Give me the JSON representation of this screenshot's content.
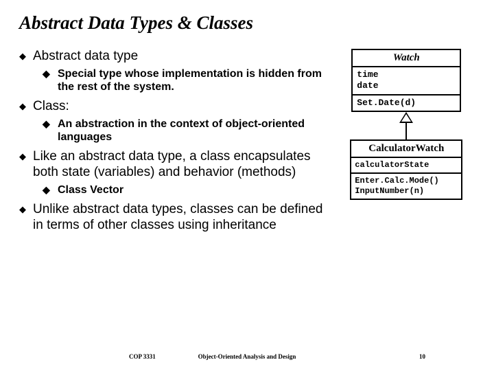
{
  "title": "Abstract Data Types & Classes",
  "bullets": {
    "b1": "Abstract data type",
    "b1_sub": "Special type whose implementation is hidden from the rest of the system.",
    "b2": "Class:",
    "b2_sub": "An abstraction in the context of object-oriented languages",
    "b3": "Like an abstract data type, a class encapsulates both state (variables) and behavior (methods)",
    "b3_sub": "Class Vector",
    "b4": "Unlike abstract data types, classes can be defined in terms of other classes using inheritance"
  },
  "uml": {
    "parent": {
      "name": "Watch",
      "attrs": "time\ndate",
      "ops": "Set.Date(d)"
    },
    "child": {
      "name": "CalculatorWatch",
      "attrs": "calculatorState",
      "ops": "Enter.Calc.Mode()\nInputNumber(n)"
    }
  },
  "footer": {
    "left": "COP 3331",
    "center": "Object-Oriented Analysis and Design",
    "right": "10"
  },
  "markers": {
    "diamond": "◆",
    "disc": "◆"
  }
}
